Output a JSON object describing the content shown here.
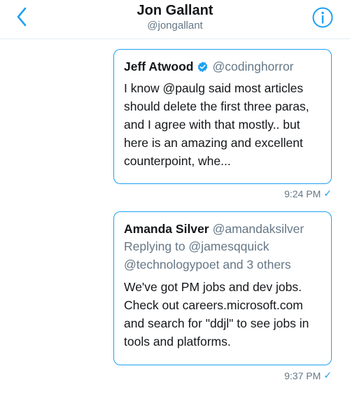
{
  "header": {
    "title": "Jon Gallant",
    "subtitle": "@jongallant"
  },
  "messages": [
    {
      "author": "Jeff Atwood",
      "verified": true,
      "handle": "@codinghorror",
      "body": "I know @paulg said most articles should delete the first three paras, and I agree with that mostly.. but here is an amazing and excellent counterpoint, whe...",
      "time": "9:24 PM"
    },
    {
      "author": "Amanda Silver",
      "verified": false,
      "handle": "@amandaksilver",
      "reply_line_1": "Replying to @jamesqquick",
      "reply_line_2": "@technologypoet and 3 others",
      "body": "We've got PM jobs and dev jobs. Check out careers.microsoft.com and search for \"ddjl\" to see jobs in tools and platforms.",
      "time": "9:37 PM"
    }
  ],
  "colors": {
    "accent": "#1da1f2",
    "secondary_text": "#657786",
    "primary_text": "#14171a"
  }
}
